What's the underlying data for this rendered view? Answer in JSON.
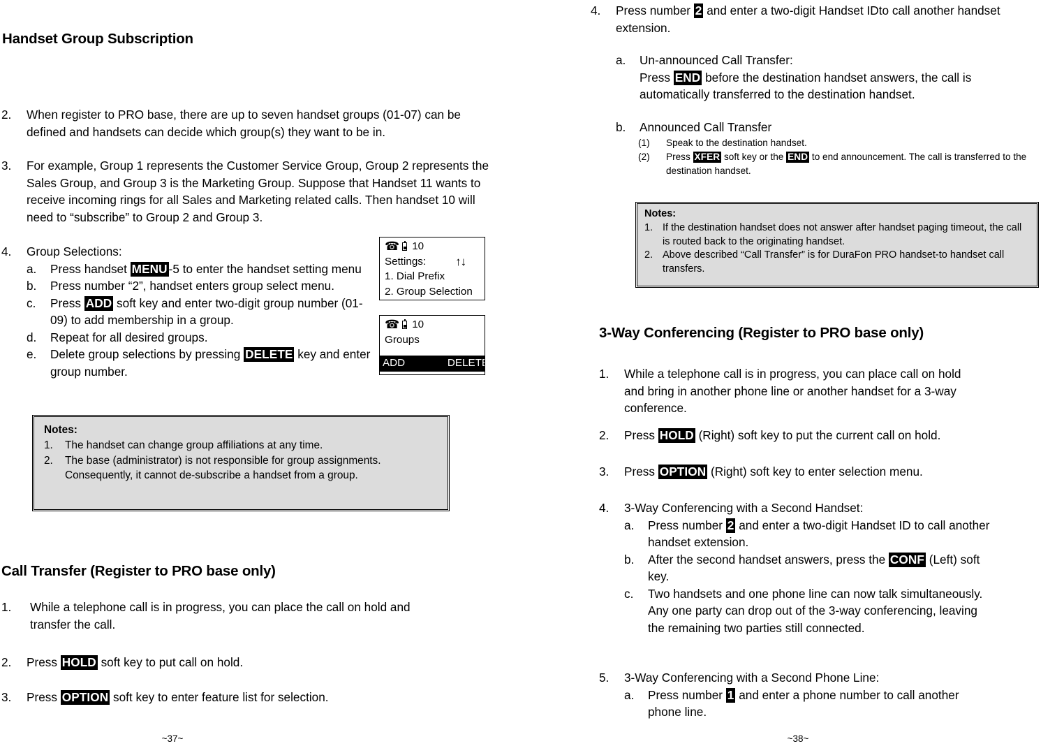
{
  "left_page": {
    "heading": "Handset Group Subscription",
    "items": [
      {
        "marker": "2.",
        "text": "When register to PRO base, there are up to seven handset groups (01-07) can be defined and handsets can decide which group(s) they want to be in."
      },
      {
        "marker": "3.",
        "text": "For example, Group 1 represents the Customer Service Group, Group 2 represents the Sales Group, and Group 3 is the Marketing Group.  Suppose that Handset 11 wants to receive incoming rings for all Sales and Marketing related calls.  Then handset 10 will need to “subscribe” to Group 2 and Group 3."
      }
    ],
    "group_selections": {
      "marker": "4.",
      "title": "Group Selections:",
      "sub": [
        {
          "marker": "a.",
          "pre": "Press handset ",
          "key": "MENU",
          "post": "-5 to enter the handset setting menu"
        },
        {
          "marker": "b.",
          "pre": "Press number “2”, handset enters group select menu.",
          "key": "",
          "post": ""
        },
        {
          "marker": "c.",
          "pre": "Press ",
          "key": "ADD",
          "post": " soft key and enter two-digit group number (01-09) to add membership in a group."
        },
        {
          "marker": "d.",
          "pre": "Repeat for all desired groups.",
          "key": "",
          "post": ""
        },
        {
          "marker": "e.",
          "pre": "Delete group selections by pressing ",
          "key": "DELETE",
          "post": " key and enter group number."
        }
      ]
    },
    "lcd_settings": {
      "handset_id": "10",
      "line1": "Settings:",
      "arrows": "↑↓",
      "line2": "1. Dial Prefix",
      "line3": "2. Group Selection"
    },
    "lcd_groups": {
      "handset_id": "10",
      "line1": "Groups",
      "softkey_left": "ADD",
      "softkey_right": "DELETE"
    },
    "notes": {
      "title": "Notes:",
      "items": [
        {
          "marker": "1.",
          "text": "The handset can change group affiliations at any time."
        },
        {
          "marker": "2.",
          "text": "The base (administrator) is not responsible for group assignments.  Consequently, it cannot de-subscribe a handset from a group."
        }
      ]
    },
    "call_transfer": {
      "heading": "Call Transfer (Register to PRO base only)",
      "items": [
        {
          "marker": "1.",
          "pre": "While a telephone call is in progress, you can place the call on hold and transfer the call.",
          "key": "",
          "post": ""
        },
        {
          "marker": "2.",
          "pre": "Press ",
          "key": "HOLD",
          "post": " soft key to put call on hold."
        },
        {
          "marker": "3.",
          "pre": "Press ",
          "key": "OPTION",
          "post": " soft key to enter feature list for selection."
        }
      ]
    },
    "page_number": "~37~"
  },
  "right_page": {
    "item4": {
      "marker": "4.",
      "pre": "Press number ",
      "key": "2",
      "post": " and enter a two-digit Handset IDto call another handset extension."
    },
    "sub_a": {
      "marker": "a.",
      "title": "Un-announced Call Transfer:",
      "pre": "Press ",
      "key": "END",
      "post": " before the destination handset answers, the call is automatically transferred to the destination handset."
    },
    "sub_b": {
      "marker": "b.",
      "title": "Announced Call Transfer",
      "steps": [
        {
          "marker": "(1)",
          "pre": "Speak to the destination handset.",
          "key1": "",
          "mid": "",
          "key2": "",
          "post": ""
        },
        {
          "marker": "(2)",
          "pre": "Press ",
          "key1": "XFER",
          "mid": " soft key or the ",
          "key2": "END",
          "post": " to end announcement. The call is transferred to the destination handset."
        }
      ]
    },
    "notes": {
      "title": "Notes:",
      "items": [
        {
          "marker": "1.",
          "text": "If the destination handset does not answer after handset paging timeout, the call is routed back to the originating handset."
        },
        {
          "marker": "2.",
          "text": "Above described “Call Transfer” is for DuraFon PRO handset-to handset call transfers."
        }
      ]
    },
    "conferencing": {
      "heading": "3-Way Conferencing (Register to PRO base only)",
      "items": [
        {
          "marker": "1.",
          "pre": "While a telephone call is in progress, you can place call on hold and bring in another phone line or another handset for a 3-way conference.",
          "key": "",
          "post": ""
        },
        {
          "marker": "2.",
          "pre": "Press ",
          "key": "HOLD",
          "post": " (Right) soft key to put the current call on hold."
        },
        {
          "marker": "3.",
          "pre": "Press ",
          "key": "OPTION",
          "post": " (Right) soft key to enter selection menu."
        }
      ],
      "item4": {
        "marker": "4.",
        "title": "3-Way Conferencing with a Second Handset:",
        "sub": [
          {
            "marker": "a.",
            "pre": "Press number ",
            "key": "2",
            "post": " and enter a two-digit Handset ID to call another handset extension."
          },
          {
            "marker": "b.",
            "pre": "After the second handset answers, press the ",
            "key": "CONF",
            "post": " (Left) soft key."
          },
          {
            "marker": "c.",
            "pre": "Two handsets and one phone line can now talk simultaneously.  Any one party can drop out of the 3-way conferencing, leaving the remaining two parties still connected.",
            "key": "",
            "post": ""
          }
        ]
      },
      "item5": {
        "marker": "5.",
        "title": "3-Way Conferencing with a Second Phone Line:",
        "sub": [
          {
            "marker": "a.",
            "pre": "Press number ",
            "key": "1",
            "post": " and enter a phone number to call another phone line."
          }
        ]
      }
    },
    "page_number": "~38~"
  },
  "icons": {
    "phone": "☎",
    "battery": "battery-icon",
    "arrow_up": "↑",
    "arrow_down": "↓"
  },
  "colors": {
    "key_bg": "#000000",
    "key_fg": "#ffffff",
    "notes_bg": "#dcdcdc",
    "page_bg": "#ffffff",
    "text": "#000000"
  }
}
